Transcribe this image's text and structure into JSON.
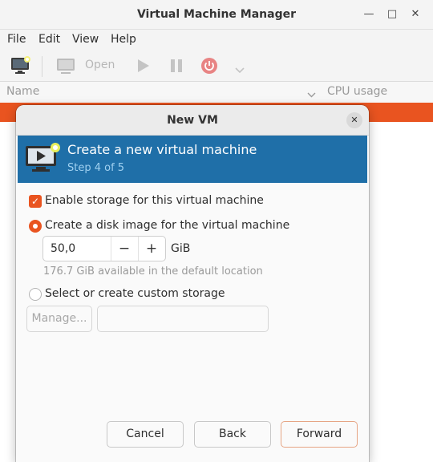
{
  "window": {
    "title": "Virtual Machine Manager",
    "controls": {
      "minimize": "—",
      "maximize": "□",
      "close": "✕"
    }
  },
  "menu": [
    "File",
    "Edit",
    "View",
    "Help"
  ],
  "toolbar": {
    "new_vm_icon": "monitor-new-icon",
    "open_icon": "monitor-icon",
    "open_label": "Open",
    "run_icon": "play-icon",
    "pause_icon": "pause-icon",
    "shutdown_icon": "power-icon",
    "dropdown_icon": "chevron-down-icon"
  },
  "vm_list": {
    "col_name": "Name",
    "col_cpu": "CPU usage",
    "selected_color": "#e95420"
  },
  "dialog": {
    "title": "New VM",
    "close_icon": "close-icon",
    "header": {
      "title": "Create a new virtual machine",
      "step": "Step 4 of 5",
      "bg_color": "#1f6fa8"
    },
    "enable_storage": {
      "label": "Enable storage for this virtual machine",
      "checked": true
    },
    "create_disk": {
      "label": "Create a disk image for the virtual machine",
      "selected": true
    },
    "disk_size": {
      "value": "50,0",
      "unit": "GiB",
      "minus": "−",
      "plus": "+"
    },
    "available_hint": "176.7 GiB available in the default location",
    "custom_storage": {
      "label": "Select or create custom storage",
      "selected": false
    },
    "manage_button": "Manage...",
    "custom_path_value": "",
    "buttons": {
      "cancel": "Cancel",
      "back": "Back",
      "forward": "Forward"
    }
  },
  "accent_color": "#e95420"
}
